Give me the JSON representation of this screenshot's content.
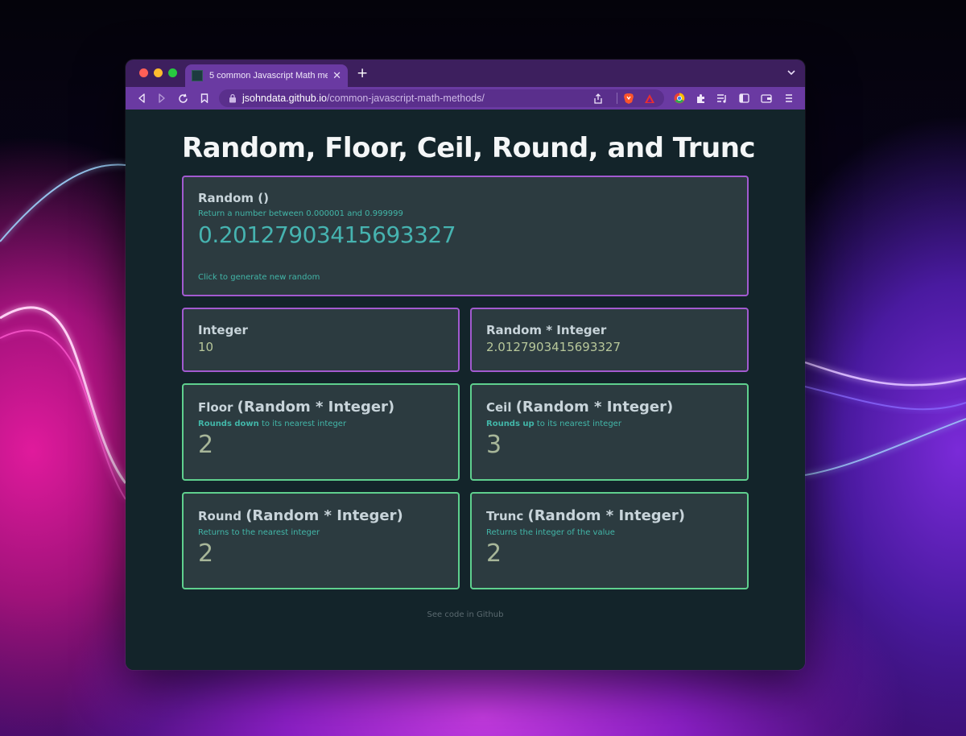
{
  "browser": {
    "tab_title": "5 common Javascript Math met",
    "url_host": "jsohndata.github.io",
    "url_path": "/common-javascript-math-methods/",
    "accent": "#6a3aa2"
  },
  "page": {
    "title": "Random, Floor, Ceil, Round, and Trunc",
    "random_card": {
      "title": "Random ()",
      "subtitle": "Return a number between 0.000001 and 0.999999",
      "value": "0.20127903415693327",
      "link": "Click to generate new random"
    },
    "integer_card": {
      "title": "Integer",
      "value": "10"
    },
    "product_card": {
      "title": "Random * Integer",
      "value": "2.0127903415693327"
    },
    "floor_card": {
      "title_method": "Floor",
      "title_args": "(Random * Integer)",
      "sub_bold": "Rounds down",
      "sub_rest": " to its nearest integer",
      "value": "2"
    },
    "ceil_card": {
      "title_method": "Ceil",
      "title_args": "(Random * Integer)",
      "sub_bold": "Rounds up",
      "sub_rest": " to its nearest integer",
      "value": "3"
    },
    "round_card": {
      "title_method": "Round",
      "title_args": "(Random * Integer)",
      "subtitle": "Returns to the nearest integer",
      "value": "2"
    },
    "trunc_card": {
      "title_method": "Trunc",
      "title_args": "(Random * Integer)",
      "subtitle": "Returns the integer of the value",
      "value": "2"
    },
    "footer": "See code in Github"
  },
  "colors": {
    "purple_border": "#a25ad0",
    "green_border": "#5fd08e",
    "teal_text": "#42b6a8"
  }
}
